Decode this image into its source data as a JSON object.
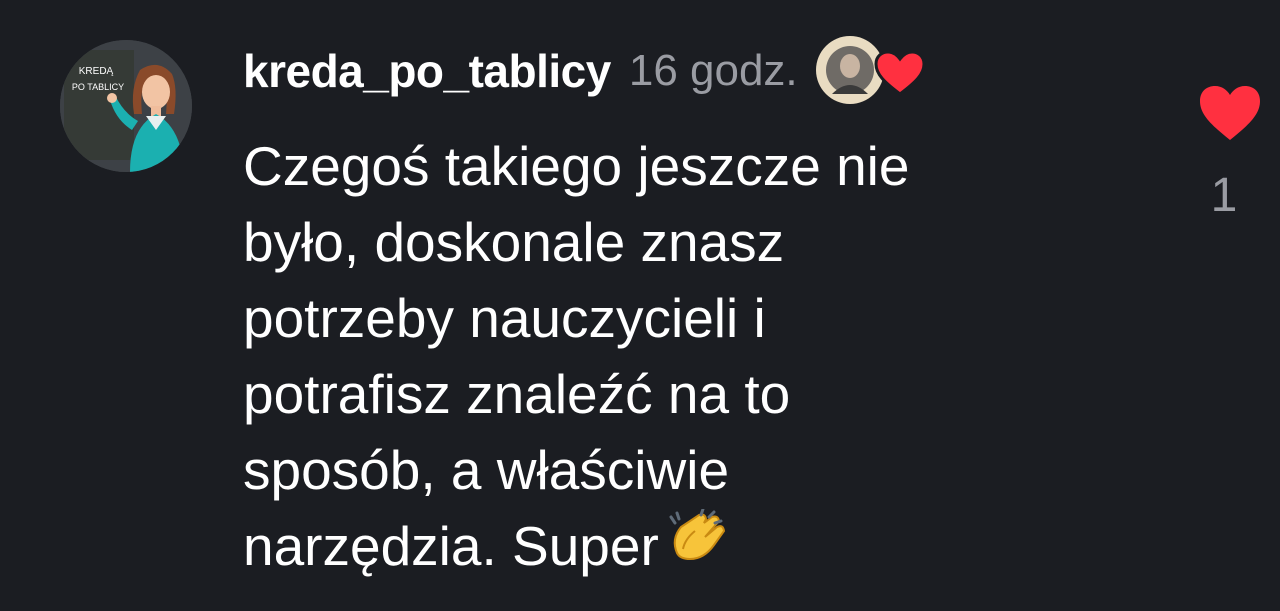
{
  "comment": {
    "username": "kreda_po_tablicy",
    "time_ago": "16 godz.",
    "avatar_text_line1": "KREDĄ",
    "avatar_text_line2": "PO TABLICY",
    "body": "Czegoś takiego jeszcze nie\nbyło, doskonale znasz\npotrzeby nauczycieli i\npotrafisz znaleźć na to\nsposób, a właściwie\nnarzędzia. Super",
    "like_count": "1"
  },
  "icons": {
    "like": "heart-icon",
    "creator_like": "heart-icon",
    "emoji": "clapping-hands-icon"
  },
  "colors": {
    "background": "#1b1d22",
    "text": "#ffffff",
    "muted": "#9a9ca3",
    "heart": "#ff3040"
  }
}
